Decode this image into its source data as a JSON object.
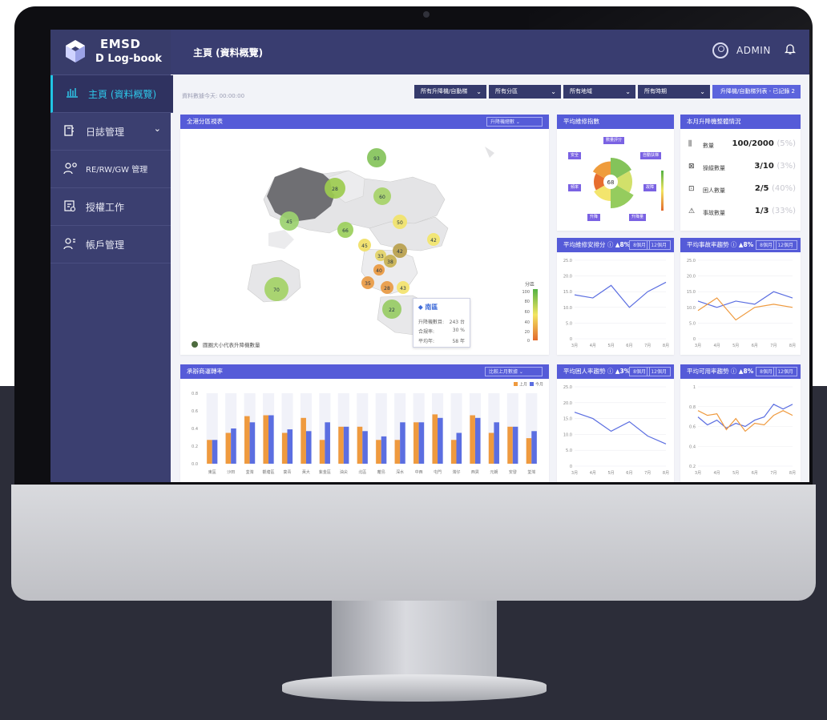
{
  "app": {
    "logo_line1": "EMSD",
    "logo_line2": "D Log-book"
  },
  "sidebar": {
    "items": [
      {
        "label": "主頁 (資料概覽)",
        "icon": "bar-chart-icon"
      },
      {
        "label": "日誌管理",
        "icon": "logbook-icon"
      },
      {
        "label": "RE/RW/GW 管理",
        "icon": "people-gear-icon"
      },
      {
        "label": "授權工作",
        "icon": "auth-document-icon"
      },
      {
        "label": "帳戶管理",
        "icon": "account-icon"
      }
    ]
  },
  "header": {
    "page_title": "主頁 (資料概覽)",
    "user": "ADMIN"
  },
  "toolbar": {
    "update_text": "資料數據今天: 00:00:00",
    "filters": [
      "所有升降機/自動梯",
      "所有分區",
      "所有地域",
      "所有時期"
    ],
    "link_label": "升降機/自動梯列表 - 已記錄 2"
  },
  "map_card": {
    "title": "全港分區視表",
    "dropdown": "升降機總數",
    "legend": "圓圈大小代表升降機數量",
    "districts": [
      "93",
      "28",
      "60",
      "45",
      "50",
      "66",
      "42",
      "45",
      "33",
      "38",
      "42",
      "40",
      "35",
      "70",
      "28",
      "43",
      "22"
    ],
    "scale_title": "分區",
    "scale_ticks": [
      "100",
      "80",
      "60",
      "40",
      "20",
      "0"
    ],
    "tooltip": {
      "title": "南區",
      "rows": [
        [
          "升降機數目:",
          "243 台"
        ],
        [
          "合規率:",
          "30 %"
        ],
        [
          "平均年:",
          "58 年"
        ]
      ]
    }
  },
  "safety_card": {
    "title": "平均維修指數",
    "center_value": "68",
    "tags": [
      "數量評分",
      "安全",
      "自動扶梯",
      "頻率",
      "故障",
      "升降",
      "升降量",
      "通常"
    ]
  },
  "monthly_card": {
    "title": "本月升降機整體情況",
    "rows": [
      {
        "label": "數量",
        "icon": "stack-icon",
        "value": "100/2000",
        "pct": "(5%)"
      },
      {
        "label": "操縱數量",
        "icon": "control-icon",
        "value": "3/10",
        "pct": "(3%)"
      },
      {
        "label": "困人數量",
        "icon": "person-trapped-icon",
        "value": "2/5",
        "pct": "(40%)"
      },
      {
        "label": "事故數量",
        "icon": "incident-icon",
        "value": "1/3",
        "pct": "(33%)"
      }
    ]
  },
  "trend1": {
    "title": "平均維修安排分",
    "delta": "8",
    "chips": [
      "8個月",
      "12個月"
    ],
    "yticks": [
      "25.0",
      "20.0",
      "15.0",
      "10.0",
      "5.0",
      "0"
    ],
    "xticks": [
      "3月",
      "4月",
      "5月",
      "6月",
      "7月",
      "8月"
    ],
    "series": [
      {
        "values": [
          14,
          13,
          17,
          10,
          15,
          18
        ]
      }
    ]
  },
  "trend2": {
    "title": "平均事故率趨勢",
    "delta": "8",
    "chips": [
      "8個月",
      "12個月"
    ],
    "yticks": [
      "25.0",
      "20.0",
      "15.0",
      "10.0",
      "5.0",
      "0"
    ],
    "xticks": [
      "3月",
      "4月",
      "5月",
      "6月",
      "7月",
      "8月"
    ],
    "series": [
      {
        "values": [
          12,
          10,
          12,
          11,
          15,
          13
        ]
      },
      {
        "values": [
          9,
          13,
          6,
          10,
          11,
          10
        ]
      }
    ]
  },
  "bar_card": {
    "title": "承辦商運轉率",
    "dropdown": "比較上月數據",
    "legend": [
      "上月",
      "今月"
    ],
    "yticks": [
      "0.8",
      "0.6",
      "0.4",
      "0.2",
      "0.0"
    ],
    "chart_data": {
      "type": "bar",
      "categories": [
        "東區",
        "沙田",
        "荃灣",
        "觀塘區",
        "葵青",
        "黃大",
        "紫金區",
        "油尖",
        "北區",
        "離島",
        "深水",
        "中西",
        "屯門",
        "灣仔",
        "西貢",
        "元朗",
        "安發",
        "荃灣"
      ],
      "series": [
        {
          "name": "上月",
          "values": [
            0.27,
            0.35,
            0.54,
            0.55,
            0.35,
            0.52,
            0.27,
            0.42,
            0.42,
            0.27,
            0.27,
            0.47,
            0.56,
            0.27,
            0.55,
            0.35,
            0.42,
            0.29
          ]
        },
        {
          "name": "今月",
          "values": [
            0.27,
            0.4,
            0.47,
            0.55,
            0.39,
            0.37,
            0.47,
            0.42,
            0.37,
            0.31,
            0.47,
            0.47,
            0.52,
            0.35,
            0.52,
            0.47,
            0.42,
            0.37
          ]
        }
      ],
      "ylim": [
        0,
        0.8
      ]
    }
  },
  "trend3": {
    "title": "平均困人率趨勢",
    "delta": "3",
    "chips": [
      "8個月",
      "12個月"
    ],
    "yticks": [
      "25.0",
      "20.0",
      "15.0",
      "10.0",
      "5.0",
      "0"
    ],
    "xticks": [
      "3月",
      "4月",
      "5月",
      "6月",
      "7月",
      "8月"
    ],
    "series": [
      {
        "values": [
          17,
          15,
          11,
          14,
          9.5,
          7
        ]
      }
    ]
  },
  "trend4": {
    "title": "平均可用率趨勢",
    "delta": "8",
    "chips": [
      "8個月",
      "12個月"
    ],
    "yticks": [
      "1",
      "0.8",
      "0.6",
      "0.4",
      "0.2"
    ],
    "xticks": [
      "3月",
      "4月",
      "5月",
      "6月",
      "7月",
      "8月"
    ],
    "series": [
      {
        "values": [
          0.62,
          0.52,
          0.58,
          0.48,
          0.54,
          0.5,
          0.58,
          0.62,
          0.78,
          0.72,
          0.78
        ]
      },
      {
        "values": [
          0.7,
          0.64,
          0.66,
          0.46,
          0.6,
          0.44,
          0.54,
          0.52,
          0.64,
          0.7,
          0.64
        ]
      }
    ]
  }
}
